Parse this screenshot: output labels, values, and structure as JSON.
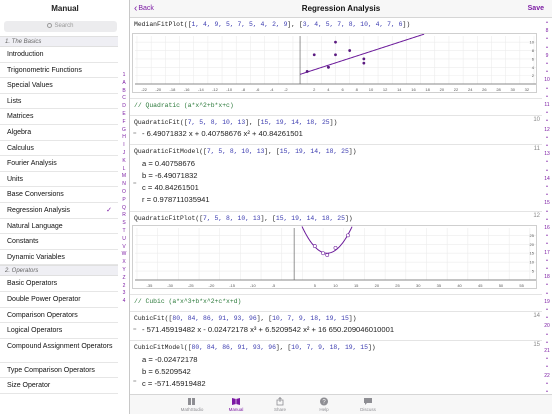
{
  "left": {
    "title": "Manual",
    "search_placeholder": "Search",
    "sections": [
      {
        "header": "1. The Basics",
        "items": [
          {
            "label": "Introduction",
            "selected": false
          },
          {
            "label": "Trigonometric Functions",
            "selected": false
          },
          {
            "label": "Special Values",
            "selected": false
          },
          {
            "label": "Lists",
            "selected": false
          },
          {
            "label": "Matrices",
            "selected": false
          },
          {
            "label": "Algebra",
            "selected": false
          },
          {
            "label": "Calculus",
            "selected": false
          },
          {
            "label": "Fourier Analysis",
            "selected": false
          },
          {
            "label": "Units",
            "selected": false
          },
          {
            "label": "Base Conversions",
            "selected": false
          },
          {
            "label": "Regression Analysis",
            "selected": true
          },
          {
            "label": "Natural Language",
            "selected": false
          },
          {
            "label": "Constants",
            "selected": false
          },
          {
            "label": "Dynamic Variables",
            "selected": false
          }
        ]
      },
      {
        "header": "2. Operators",
        "items": [
          {
            "label": "Basic Operators",
            "selected": false
          },
          {
            "label": "Double Power Operator",
            "selected": false
          },
          {
            "label": "Comparison Operators",
            "selected": false
          },
          {
            "label": "Logical Operators",
            "selected": false
          },
          {
            "label": "Compound Assignment Operators",
            "selected": false
          },
          {
            "label": "Type Comparison Operators",
            "selected": false
          },
          {
            "label": "Size Operator",
            "selected": false
          }
        ]
      }
    ],
    "index_letters": [
      "1",
      "A",
      "B",
      "C",
      "D",
      "E",
      "F",
      "G",
      "H",
      "I",
      "J",
      "K",
      "L",
      "M",
      "N",
      "O",
      "P",
      "Q",
      "R",
      "S",
      "T",
      "U",
      "V",
      "W",
      "X",
      "Y",
      "Z",
      "2",
      "3",
      "4"
    ]
  },
  "navbar": {
    "back_label": "Back",
    "title": "Regression Analysis",
    "save_label": "Save"
  },
  "cells": {
    "c1": {
      "code_prefix": "MedianFitPlot([",
      "code_list1": "1, 4, 9, 5, 7, 5, 4, 2, 9",
      "code_mid": "], [",
      "code_list2": "3, 4, 5, 7, 8, 10, 4, 7, 6",
      "code_suffix": "])",
      "linenum": ""
    },
    "plot1": {
      "x_ticks": [
        "-22",
        "-20",
        "-18",
        "-16",
        "-14",
        "-12",
        "-10",
        "-8",
        "-6",
        "-4",
        "-2",
        "2",
        "4",
        "6",
        "8",
        "10",
        "12",
        "14",
        "16",
        "18",
        "20",
        "22",
        "24",
        "26",
        "28",
        "30",
        "32"
      ],
      "y_ticks": [
        "10",
        "8",
        "6",
        "4",
        "2"
      ]
    },
    "comment_quadratic": "// Quadratic (a*x^2+b*x+c)",
    "c2": {
      "code_prefix": "QuadraticFit([",
      "code_list1": "7, 5, 8, 10, 13",
      "code_mid": "], [",
      "code_list2": "15, 19, 14, 18, 25",
      "code_suffix": "])",
      "linenum": "10",
      "output": "- 6.49071832 x + 0.40758676 x² + 40.84261501"
    },
    "c3": {
      "code_prefix": "QuadraticFitModel([",
      "code_list1": "7, 5, 8, 10, 13",
      "code_mid": "], [",
      "code_list2": "15, 19, 14, 18, 25",
      "code_suffix": "])",
      "linenum": "11",
      "rows": [
        "a = 0.40758676",
        "b = -6.49071832",
        "c = 40.84261501",
        "r = 0.978711035941"
      ]
    },
    "c4": {
      "code_prefix": "QuadraticFitPlot([",
      "code_list1": "7, 5, 8, 10, 13",
      "code_mid": "], [",
      "code_list2": "15, 19, 14, 18, 25",
      "code_suffix": "])",
      "linenum": "12"
    },
    "plot2": {
      "x_ticks": [
        "-35",
        "-30",
        "-25",
        "-20",
        "-15",
        "-10",
        "-5",
        "5",
        "10",
        "15",
        "20",
        "25",
        "30",
        "35",
        "40",
        "45",
        "50",
        "55"
      ],
      "y_ticks": [
        "25",
        "20",
        "15",
        "10",
        "5"
      ]
    },
    "comment_cubic": "// Cubic (a*x^3+b*x^2+c*x+d)",
    "c5": {
      "code_prefix": "CubicFit([",
      "code_list1": "80, 84, 86, 91, 93, 96",
      "code_mid": "], [",
      "code_list2": "10, 7, 9, 18, 19, 15",
      "code_suffix": "])",
      "linenum": "14",
      "output": "- 571.45919482 x - 0.02472178 x³ + 6.5209542 x² + 16 650.209046010001"
    },
    "c6": {
      "code_prefix": "CubicFitModel([",
      "code_list1": "80, 84, 86, 91, 93, 96",
      "code_mid": "], [",
      "code_list2": "10, 7, 9, 18, 19, 15",
      "code_suffix": "])",
      "linenum": "15",
      "rows": [
        "a = -0.02472178",
        "b = 6.5209542",
        "c = -571.45919482"
      ]
    }
  },
  "gutter_numbers": [
    "8",
    "9",
    "10",
    "11",
    "12",
    "13",
    "14",
    "15",
    "16",
    "17",
    "18",
    "19",
    "20",
    "21",
    "22"
  ],
  "tabs": [
    {
      "label": "MathStudio",
      "icon": "book-stack-icon",
      "active": false
    },
    {
      "label": "Manual",
      "icon": "open-book-icon",
      "active": true
    },
    {
      "label": "Share",
      "icon": "share-icon",
      "active": false
    },
    {
      "label": "Help",
      "icon": "question-icon",
      "active": false
    },
    {
      "label": "Discuss",
      "icon": "chat-bubble-icon",
      "active": false
    }
  ],
  "colors": {
    "accent": "#7b1aa3",
    "code_number": "#3b3bb0",
    "comment": "#2c7a3b",
    "fit_line": "#6b1a9a"
  }
}
